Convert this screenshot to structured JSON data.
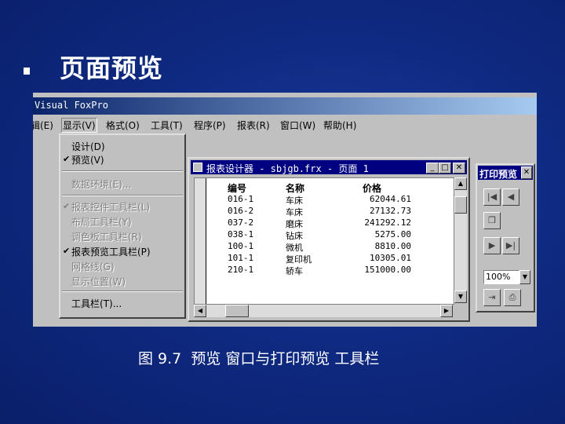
{
  "slide": {
    "title": "页面预览",
    "caption": "图 9.7  预览 窗口与打印预览 工具栏"
  },
  "app": {
    "title": "Visual FoxPro",
    "menus": [
      {
        "label": "编辑(E)"
      },
      {
        "label": "显示(V)"
      },
      {
        "label": "格式(O)"
      },
      {
        "label": "工具(T)"
      },
      {
        "label": "程序(P)"
      },
      {
        "label": "报表(R)"
      },
      {
        "label": "窗口(W)"
      },
      {
        "label": "帮助(H)"
      }
    ],
    "menu_visible_labels": [
      "辑(E)",
      "显示(V)",
      "格式(O)",
      "工具(T)",
      "程序(P)",
      "报表(R)",
      "窗口(W)",
      "帮助(H)"
    ]
  },
  "view_menu": {
    "items": [
      {
        "label": "设计(D)",
        "checked": false,
        "enabled": true
      },
      {
        "label": "预览(V)",
        "checked": true,
        "enabled": true
      },
      {
        "label": "数据环境(E)...",
        "checked": false,
        "enabled": false
      },
      {
        "label": "报表控件工具栏(L)",
        "checked": true,
        "enabled": false
      },
      {
        "label": "布局工具栏(Y)",
        "checked": false,
        "enabled": false
      },
      {
        "label": "调色板工具栏(R)",
        "checked": false,
        "enabled": false
      },
      {
        "label": "报表预览工具栏(P)",
        "checked": true,
        "enabled": true
      },
      {
        "label": "网格线(G)",
        "checked": false,
        "enabled": false
      },
      {
        "label": "显示位置(W)",
        "checked": false,
        "enabled": false
      },
      {
        "label": "工具栏(T)...",
        "checked": false,
        "enabled": true
      }
    ],
    "check_glyph": "✔"
  },
  "report_window": {
    "title": "报表设计器 - sbjgb.frx - 页面 1",
    "headers": {
      "code": "编号",
      "name": "名称",
      "price": "价格"
    },
    "rows": [
      {
        "code": "016-1",
        "name": "车床",
        "price": "62044.61"
      },
      {
        "code": "016-2",
        "name": "车床",
        "price": "27132.73"
      },
      {
        "code": "037-2",
        "name": "磨床",
        "price": "241292.12"
      },
      {
        "code": "038-1",
        "name": "钻床",
        "price": "5275.00"
      },
      {
        "code": "100-1",
        "name": "微机",
        "price": "8810.00"
      },
      {
        "code": "101-1",
        "name": "复印机",
        "price": "10305.01"
      },
      {
        "code": "210-1",
        "name": "轿车",
        "price": "151000.00"
      }
    ]
  },
  "print_preview_toolbar": {
    "title": "打印预览",
    "zoom": "100%"
  }
}
